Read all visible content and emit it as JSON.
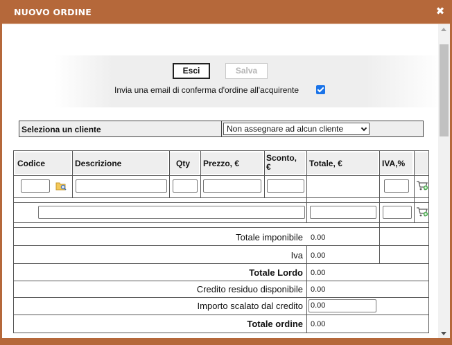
{
  "dialog": {
    "title": "NUOVO ORDINE",
    "close_glyph": "✖"
  },
  "actions": {
    "exit_label": "Esci",
    "save_label": "Salva",
    "email_confirmation_label": "Invia una email di conferma d'ordine all'acquirente",
    "email_confirmation_checked": true
  },
  "client": {
    "label": "Seleziona un cliente",
    "selected": "Non assegnare ad alcun cliente"
  },
  "table": {
    "columns": [
      "Codice",
      "Descrizione",
      "Qty",
      "Prezzo, €",
      "Sconto, €",
      "Totale, €",
      "IVA,%"
    ],
    "icons": {
      "lookup": "folder-search-icon",
      "add": "add-to-cart-icon"
    }
  },
  "summary": [
    {
      "label": "Totale imponibile",
      "value": "0.00",
      "bold": false
    },
    {
      "label": "Iva",
      "value": "0.00",
      "bold": false
    },
    {
      "label": "Totale Lordo",
      "value": "0.00",
      "bold": true
    },
    {
      "label": "Credito residuo disponibile",
      "value": "0.00",
      "bold": false
    },
    {
      "label": "Importo scalato dal credito",
      "value": "0.00",
      "bold": false
    },
    {
      "label": "Totale ordine",
      "value": "0.00",
      "bold": true
    }
  ],
  "colors": {
    "titlebar": "#b5683a",
    "checkbox": "#1a73e8"
  }
}
